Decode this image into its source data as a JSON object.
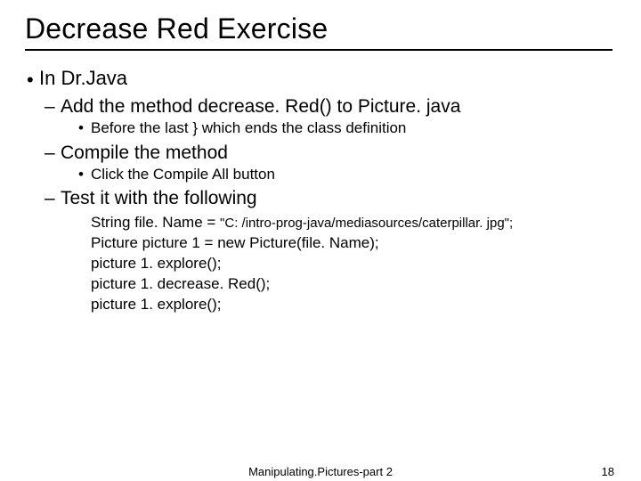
{
  "title": "Decrease Red Exercise",
  "bullet1": "In Dr.Java",
  "sub1": "Add the method decrease. Red() to Picture. java",
  "sub1_detail": "Before the last } which ends the class definition",
  "sub2": "Compile the method",
  "sub2_detail": "Click the Compile All button",
  "sub3": "Test it with the following",
  "code": {
    "l1a": "String file. Name = ",
    "l1b": "\"C: /intro-prog-java/mediasources/caterpillar. jpg\";",
    "l2": "Picture picture 1 = new Picture(file. Name);",
    "l3": "picture 1. explore();",
    "l4": "picture 1. decrease. Red();",
    "l5": "picture 1. explore();"
  },
  "footer_center": "Manipulating.Pictures-part 2",
  "footer_right": "18"
}
